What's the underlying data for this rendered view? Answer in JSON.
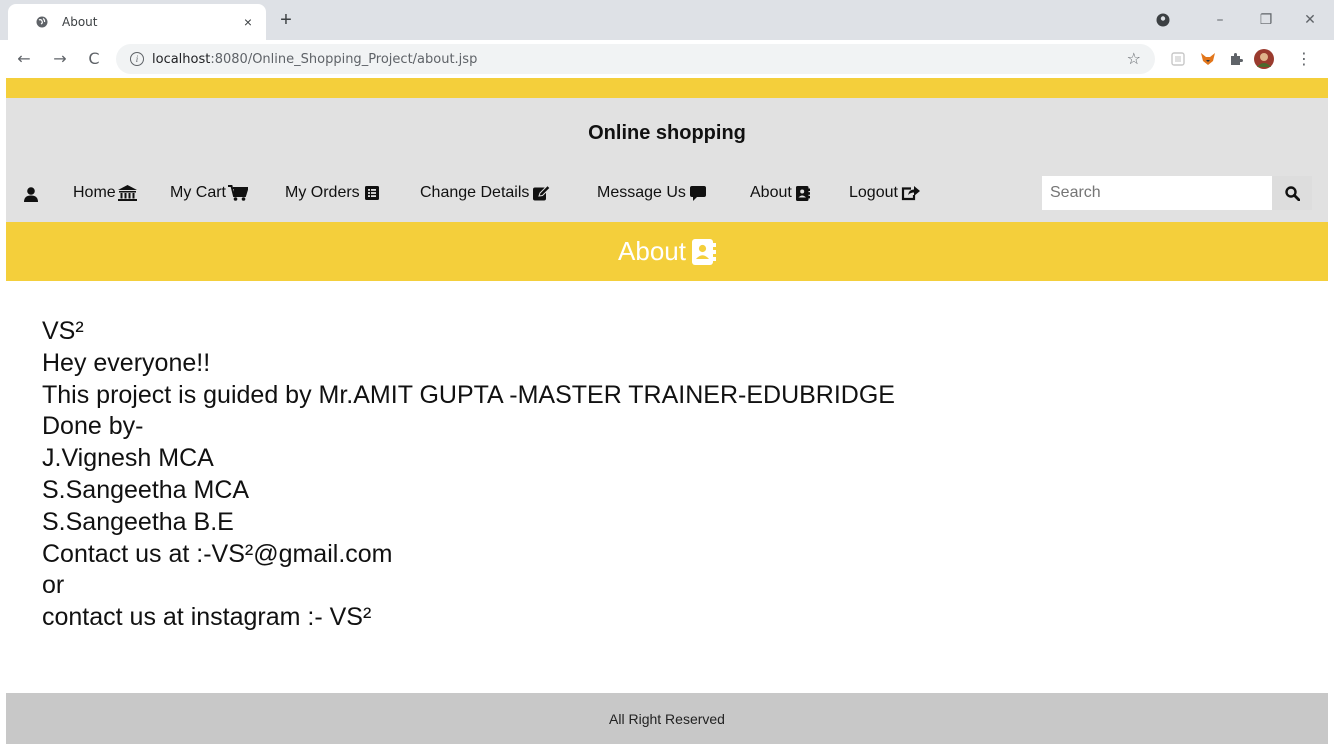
{
  "browser": {
    "tab_title": "About",
    "tab_close": "×",
    "new_tab": "+",
    "url_host": "localhost",
    "url_path": ":8080/Online_Shopping_Project/about.jsp",
    "info_glyph": "i",
    "back": "←",
    "forward": "→",
    "reload": "C",
    "star": "☆",
    "minimize": "–",
    "restore": "❐",
    "close": "✕",
    "menu": "⋮"
  },
  "site": {
    "title": "Online shopping",
    "nav": [
      {
        "label": "Home"
      },
      {
        "label": "My Cart"
      },
      {
        "label": "My Orders"
      },
      {
        "label": "Change Details"
      },
      {
        "label": "Message Us"
      },
      {
        "label": "About"
      },
      {
        "label": "Logout"
      }
    ],
    "search_placeholder": "Search",
    "banner": "About",
    "content_lines": [
      "VS²",
      "Hey everyone!!",
      "This project is guided by Mr.AMIT GUPTA -MASTER TRAINER-EDUBRIDGE",
      "Done by-",
      "J.Vignesh MCA",
      "S.Sangeetha MCA",
      "S.Sangeetha B.E",
      "Contact us at :-VS²@gmail.com",
      "or",
      "contact us at instagram :- VS²"
    ],
    "footer": "All Right Reserved"
  },
  "colors": {
    "accent_yellow": "#f4cf3b",
    "nav_bg": "#e1e1e1",
    "footer_bg": "#c8c8c8"
  }
}
